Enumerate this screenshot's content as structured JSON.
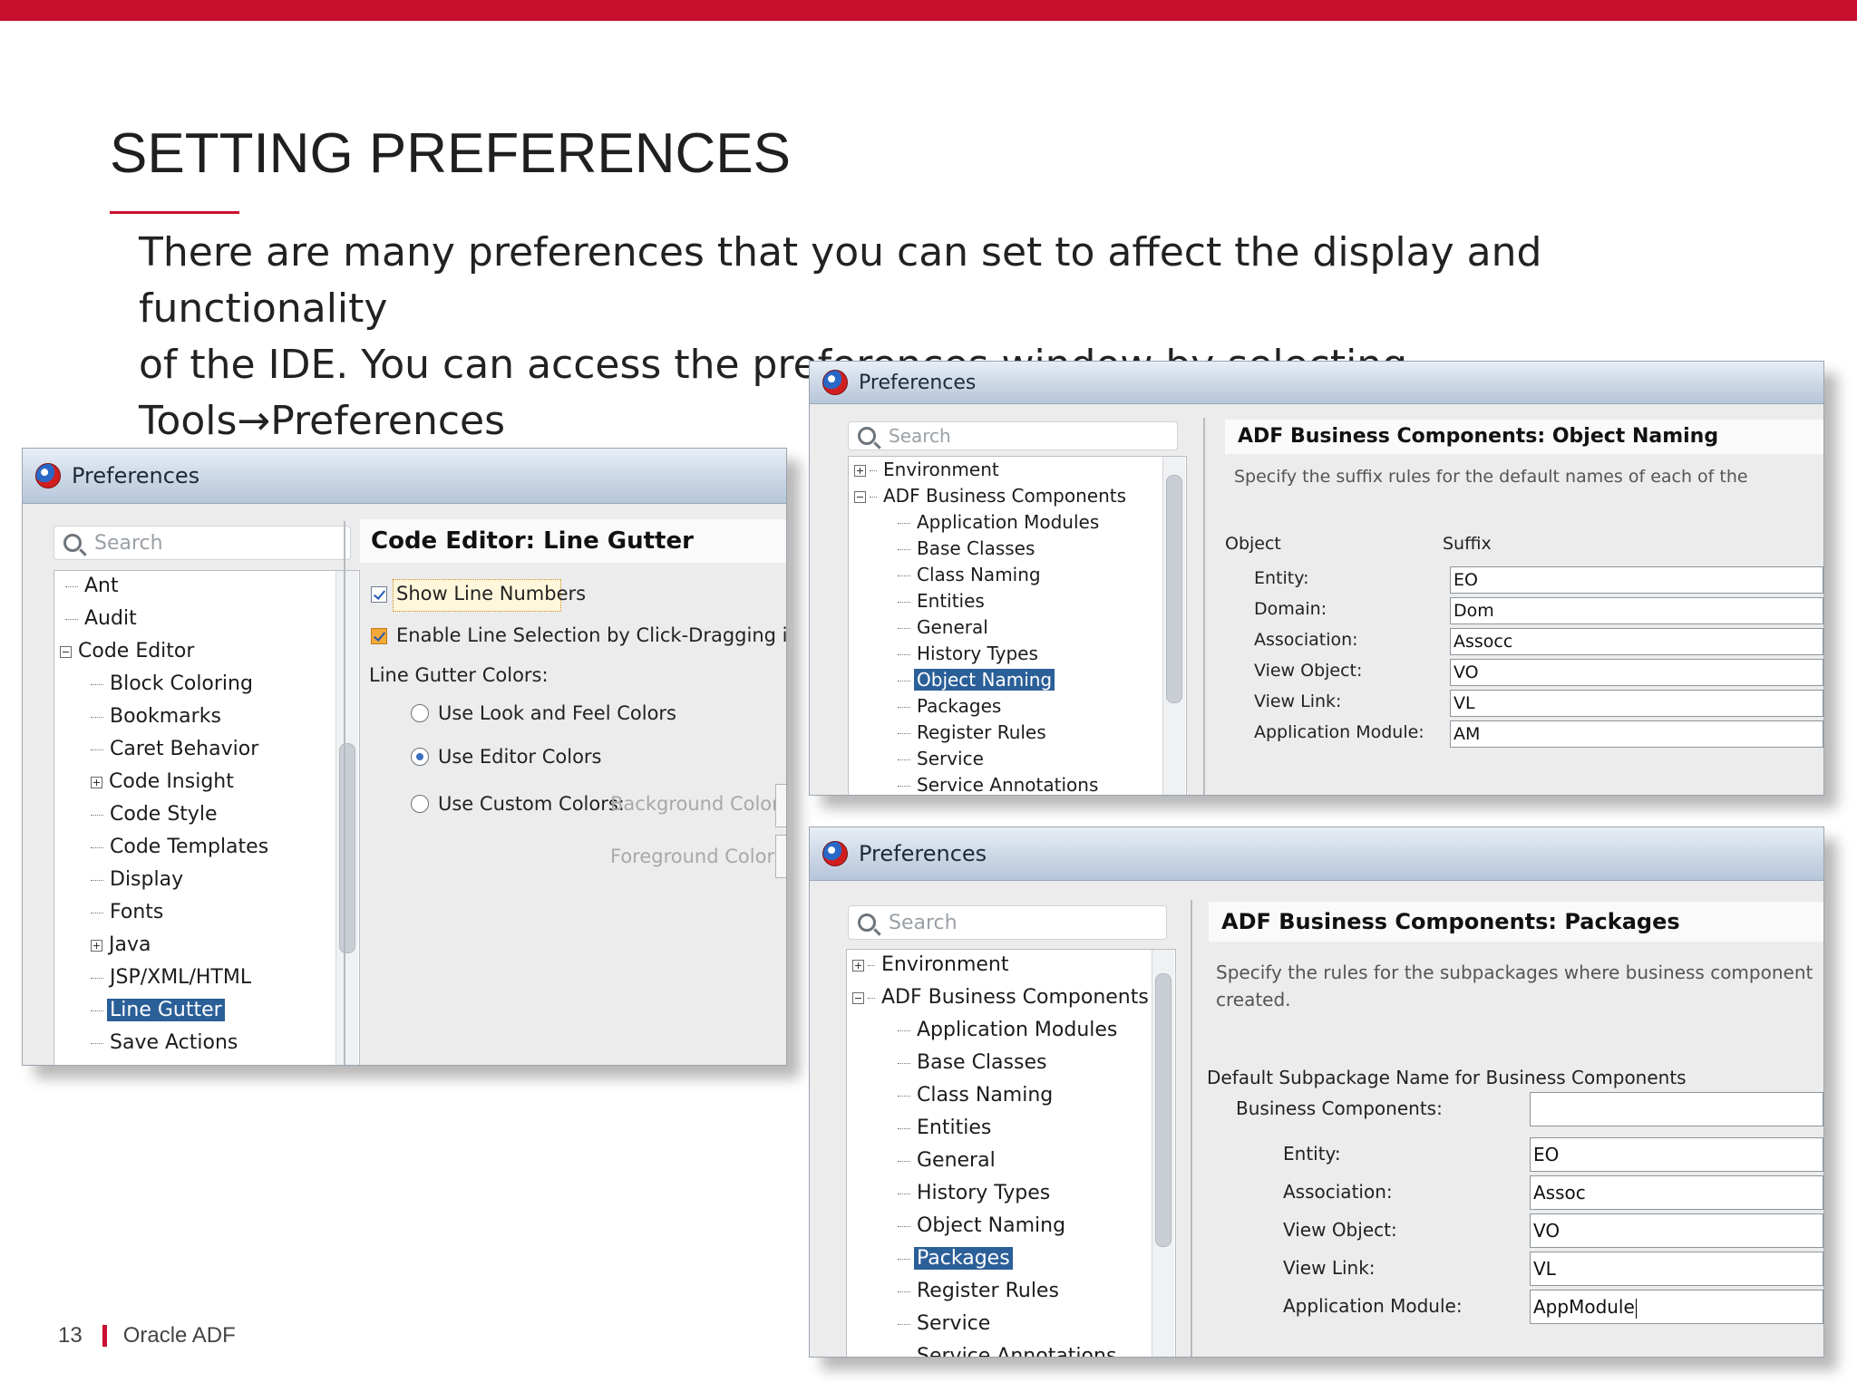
{
  "slide": {
    "title": "SETTING PREFERENCES",
    "intro_line1": "There are many preferences that you can set to affect the display and functionality",
    "intro_line2": "of the IDE. You can access the preferences window by selecting Tools",
    "intro_arrow": "→",
    "intro_line2_end": "Preferences",
    "page_number": "13",
    "footer_label": "Oracle ADF",
    "accent_color": "#c8102e"
  },
  "window_left": {
    "title": "Preferences",
    "search_placeholder": "Search",
    "tree": [
      "Ant",
      "Audit",
      "Code Editor",
      "Block Coloring",
      "Bookmarks",
      "Caret Behavior",
      "Code Insight",
      "Code Style",
      "Code Templates",
      "Display",
      "Fonts",
      "Java",
      "JSP/XML/HTML",
      "Line Gutter",
      "Save Actions"
    ],
    "selected": "Line Gutter",
    "heading": "Code Editor: Line Gutter",
    "show_line_numbers": "Show Line Numbers",
    "enable_line_selection": "Enable Line Selection by Click-Dragging in Gutter",
    "gutter_colors_label": "Line Gutter Colors:",
    "radio_look_feel": "Use Look and Feel Colors",
    "radio_editor": "Use Editor Colors",
    "radio_custom": "Use Custom Colors:",
    "background_color": "Background Color:",
    "foreground_color": "Foreground Color:"
  },
  "window_object_naming": {
    "title": "Preferences",
    "search_placeholder": "Search",
    "tree": [
      "Environment",
      "ADF Business Components",
      "Application Modules",
      "Base Classes",
      "Class Naming",
      "Entities",
      "General",
      "History Types",
      "Object Naming",
      "Packages",
      "Register Rules",
      "Service",
      "Service Annotations"
    ],
    "selected": "Object Naming",
    "heading": "ADF Business Components: Object Naming",
    "description": "Specify the suffix rules for the default names of each of the",
    "col_object": "Object",
    "col_suffix": "Suffix",
    "rows": [
      {
        "label": "Entity:",
        "value": "EO"
      },
      {
        "label": "Domain:",
        "value": "Dom"
      },
      {
        "label": "Association:",
        "value": "Assocc"
      },
      {
        "label": "View Object:",
        "value": "VO"
      },
      {
        "label": "View Link:",
        "value": "VL"
      },
      {
        "label": "Application Module:",
        "value": "AM"
      }
    ]
  },
  "window_packages": {
    "title": "Preferences",
    "search_placeholder": "Search",
    "tree": [
      "Environment",
      "ADF Business Components",
      "Application Modules",
      "Base Classes",
      "Class Naming",
      "Entities",
      "General",
      "History Types",
      "Object Naming",
      "Packages",
      "Register Rules",
      "Service",
      "Service Annotations"
    ],
    "selected": "Packages",
    "heading": "ADF Business Components: Packages",
    "description_line1": "Specify the rules for the subpackages where business component",
    "description_line2": "created.",
    "group_label": "Default Subpackage Name for Business Components",
    "business_components_label": "Business Components:",
    "business_components_value": "",
    "rows": [
      {
        "label": "Entity:",
        "value": "EO"
      },
      {
        "label": "Association:",
        "value": "Assoc"
      },
      {
        "label": "View Object:",
        "value": "VO"
      },
      {
        "label": "View Link:",
        "value": "VL"
      },
      {
        "label": "Application Module:",
        "value": "AppModule"
      }
    ]
  }
}
